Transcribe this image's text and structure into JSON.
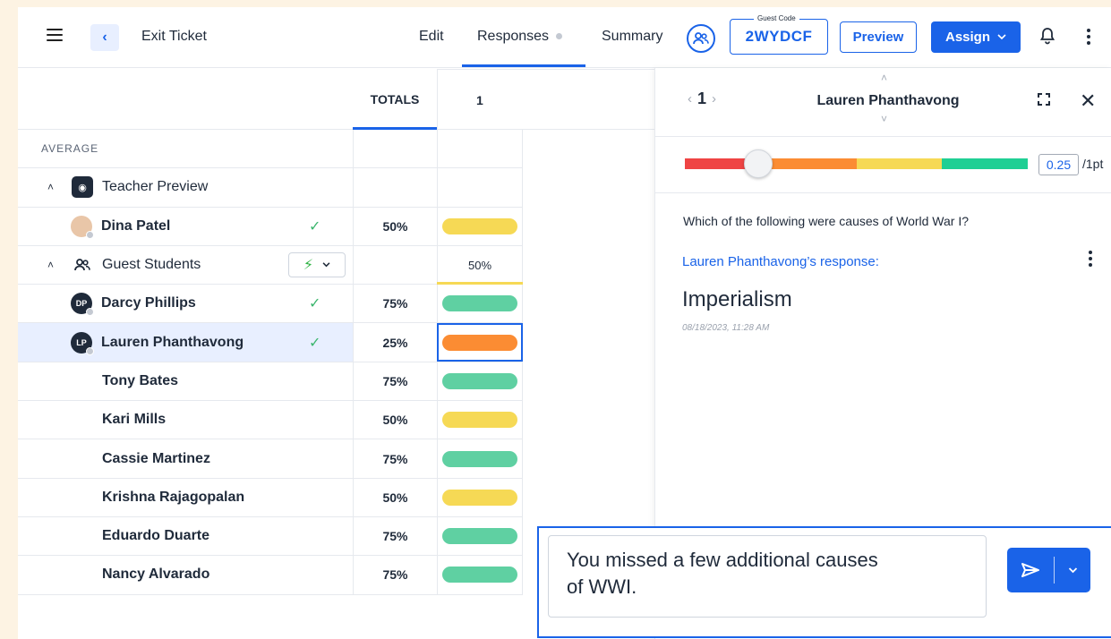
{
  "header": {
    "title": "Exit Ticket",
    "tabs": {
      "edit": "Edit",
      "responses": "Responses",
      "summary": "Summary"
    },
    "guest_code_label": "Guest Code",
    "guest_code": "2WYDCF",
    "preview_label": "Preview",
    "assign_label": "Assign"
  },
  "table": {
    "totals_header": "TOTALS",
    "question_header": "1",
    "average_label": "AVERAGE",
    "teacher_group": "Teacher Preview",
    "guest_group": "Guest Students",
    "guest_avg": "50%",
    "teacher_rows": [
      {
        "name": "Dina Patel",
        "total": "50%",
        "color": "yellow",
        "checked": true
      }
    ],
    "guest_rows": [
      {
        "initials": "DP",
        "name": "Darcy Phillips",
        "total": "75%",
        "color": "green",
        "checked": true
      },
      {
        "initials": "LP",
        "name": "Lauren Phanthavong",
        "total": "25%",
        "color": "orange",
        "checked": true,
        "selected": true
      }
    ],
    "other_rows": [
      {
        "name": "Tony Bates",
        "total": "75%",
        "color": "green"
      },
      {
        "name": "Kari Mills",
        "total": "50%",
        "color": "yellow"
      },
      {
        "name": "Cassie Martinez",
        "total": "75%",
        "color": "green"
      },
      {
        "name": "Krishna Rajagopalan",
        "total": "50%",
        "color": "yellow"
      },
      {
        "name": "Eduardo Duarte",
        "total": "75%",
        "color": "green"
      },
      {
        "name": "Nancy Alvarado",
        "total": "75%",
        "color": "green"
      }
    ]
  },
  "panel": {
    "question_number": "1",
    "student_name": "Lauren Phanthavong",
    "score_value": "0.25",
    "score_total": "/1pt",
    "score_fraction": 0.25,
    "question": "Which of the following were causes of World War I?",
    "response_label": "Lauren Phanthavong’s response:",
    "response": "Imperialism",
    "timestamp": "08/18/2023, 11:28 AM"
  },
  "feedback": {
    "line1": "You missed a few additional causes",
    "line2": "of WWI."
  },
  "colors": {
    "accent": "#1a63e8",
    "green": "#5fd0a2",
    "yellow": "#f6d955",
    "orange": "#fb8c33",
    "red": "#ef4444"
  }
}
